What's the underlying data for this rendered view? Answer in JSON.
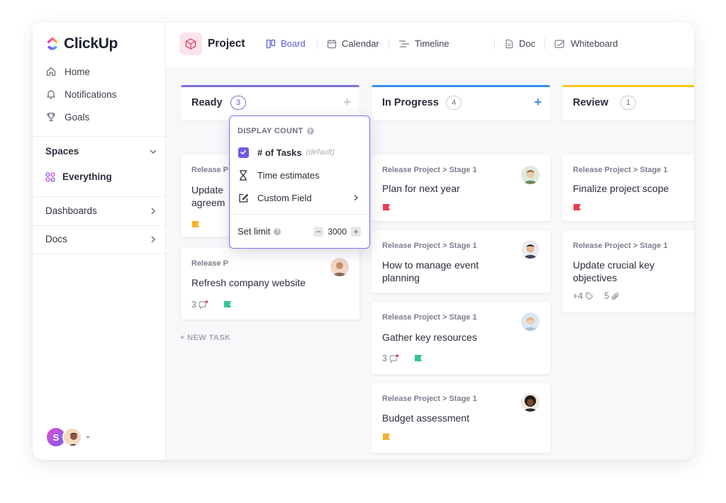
{
  "app": {
    "name": "ClickUp"
  },
  "sidebar": {
    "nav": [
      {
        "label": "Home",
        "icon": "home-icon"
      },
      {
        "label": "Notifications",
        "icon": "bell-icon"
      },
      {
        "label": "Goals",
        "icon": "trophy-icon"
      }
    ],
    "spaces_label": "Spaces",
    "everything_label": "Everything",
    "dashboards_label": "Dashboards",
    "docs_label": "Docs",
    "user_initial": "S"
  },
  "header": {
    "project_title": "Project",
    "tabs": [
      {
        "label": "Board",
        "icon": "board-icon",
        "active": true
      },
      {
        "label": "Calendar",
        "icon": "calendar-icon"
      },
      {
        "label": "Timeline",
        "icon": "timeline-icon"
      },
      {
        "label": "Doc",
        "icon": "doc-icon"
      },
      {
        "label": "Whiteboard",
        "icon": "whiteboard-icon"
      }
    ]
  },
  "columns": [
    {
      "title": "Ready",
      "count": "3",
      "color": "#7c6fe0",
      "cards": [
        {
          "crumb": "Release P",
          "title_lines": [
            "Update",
            "agreem"
          ],
          "flag": "#f2b32c"
        },
        {
          "crumb": "Release P",
          "title_lines": [
            "Refresh company website"
          ],
          "comments": "3",
          "flag": "#2fc790"
        }
      ],
      "new_task": "+ NEW TASK"
    },
    {
      "title": "In Progress",
      "count": "4",
      "color": "#3b8ee8",
      "cards": [
        {
          "crumb": "Release Project > Stage 1",
          "title_lines": [
            "Plan for next year"
          ],
          "flag": "#ea3b4e"
        },
        {
          "crumb": "Release Project > Stage 1",
          "title_lines": [
            "How to manage event",
            "planning"
          ]
        },
        {
          "crumb": "Release Project > Stage 1",
          "title_lines": [
            "Gather key resources"
          ],
          "comments": "3",
          "flag": "#2fc790"
        },
        {
          "crumb": "Release Project > Stage 1",
          "title_lines": [
            "Budget assessment"
          ],
          "flag": "#f2b32c"
        }
      ]
    },
    {
      "title": "Review",
      "count": "1",
      "color": "#f5c518",
      "cards": [
        {
          "crumb": "Release Project > Stage 1",
          "title_lines": [
            "Finalize project scope"
          ],
          "flag": "#ea3b4e"
        },
        {
          "crumb": "Release Project > Stage 1",
          "title_lines": [
            "Update crucial key",
            "objectives"
          ],
          "tags": "+4",
          "attachments": "5"
        }
      ]
    }
  ],
  "popover": {
    "heading": "DISPLAY COUNT",
    "options": [
      {
        "label": "# of Tasks",
        "note": "(default)",
        "checked": true
      },
      {
        "label": "Time estimates"
      },
      {
        "label": "Custom Field"
      }
    ],
    "limit_label": "Set limit",
    "limit_value": "3000"
  }
}
